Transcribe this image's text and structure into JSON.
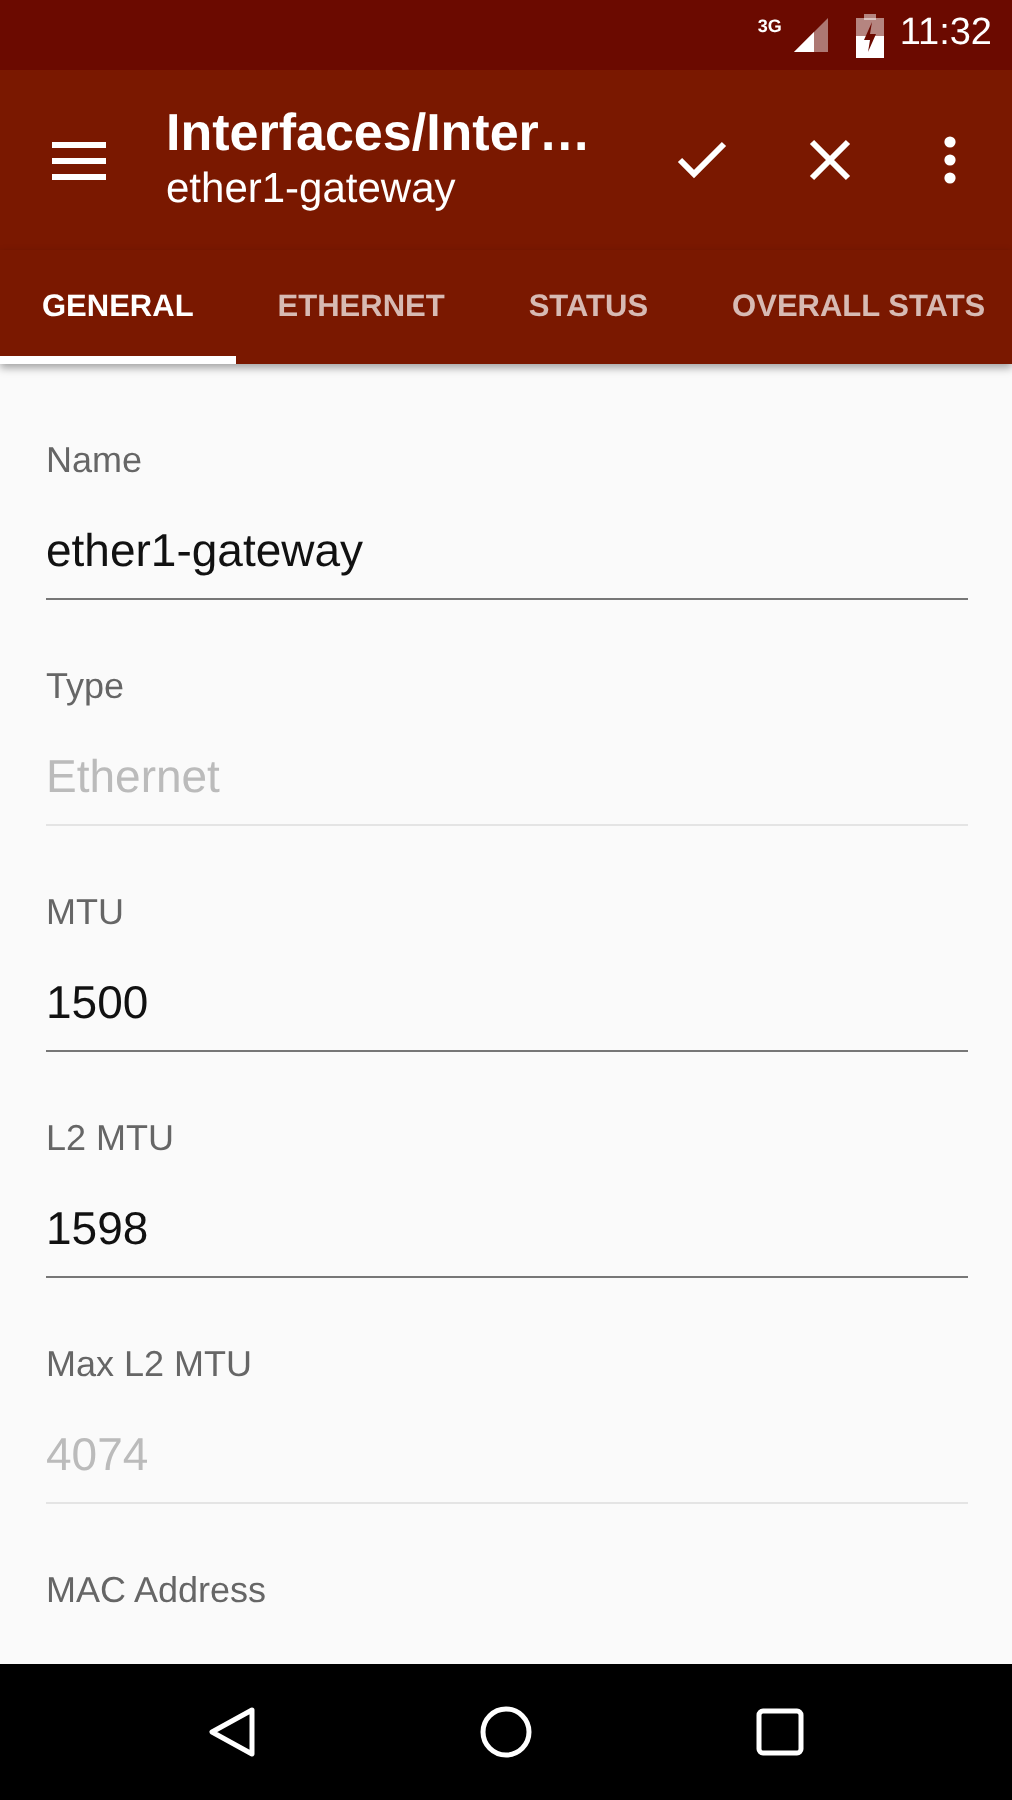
{
  "status_bar": {
    "network": "3G",
    "time": "11:32"
  },
  "toolbar": {
    "title": "Interfaces/Inter…",
    "subtitle": "ether1-gateway"
  },
  "tabs": [
    {
      "label": "GENERAL",
      "selected": true
    },
    {
      "label": "ETHERNET",
      "selected": false
    },
    {
      "label": "STATUS",
      "selected": false
    },
    {
      "label": "OVERALL STATS",
      "selected": false
    }
  ],
  "fields": [
    {
      "label": "Name",
      "value": "ether1-gateway",
      "disabled": false
    },
    {
      "label": "Type",
      "value": "Ethernet",
      "disabled": true
    },
    {
      "label": "MTU",
      "value": "1500",
      "disabled": false
    },
    {
      "label": "L2 MTU",
      "value": "1598",
      "disabled": false
    },
    {
      "label": "Max L2 MTU",
      "value": "4074",
      "disabled": true
    },
    {
      "label": "MAC Address"
    }
  ]
}
